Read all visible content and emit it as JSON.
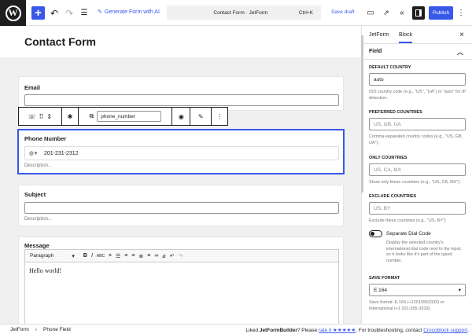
{
  "topbar": {
    "wp_logo": "W",
    "generate_label": "Generate Form with AI",
    "command_title": "Contact Form · JetForm",
    "command_shortcut": "Ctrl+K",
    "save_draft": "Save draft",
    "publish": "Publish"
  },
  "editor": {
    "title": "Contact Form",
    "email_label": "Email",
    "phone_label": "Phone Number",
    "phone_value": "201-231-2312",
    "phone_description": "Description...",
    "subject_label": "Subject",
    "subject_description": "Description...",
    "message_label": "Message",
    "message_format": "Paragraph",
    "message_text": "Hello world!"
  },
  "block_toolbar": {
    "field_name": "phone_number"
  },
  "statusbar": {
    "crumb_root": "JetForm",
    "crumb_separator": "›",
    "crumb_current": "Phone Field",
    "liked_prefix": "Liked",
    "brand": "JetFormBuilder",
    "please": "? Please",
    "rate_link": "rate it ★★★★★",
    "troubleshoot": ". For troubleshooting, contact",
    "support_link": "Crocoblock support",
    "end": "."
  },
  "sidebar": {
    "tab_form": "JetForm",
    "tab_block": "Block",
    "panel_title": "Field",
    "default_country_label": "DEFAULT COUNTRY",
    "default_country_value": "auto",
    "default_country_help": "ISO country code (e.g., \"US\", \"UA\") or \"auto\" for IP detection.",
    "preferred_label": "PREFERRED COUNTRIES",
    "preferred_placeholder": "US, GB, UA",
    "preferred_help": "Comma-separated country codes (e.g., \"US, GB, UA\").",
    "only_label": "ONLY COUNTRIES",
    "only_placeholder": "US, CA, MX",
    "only_help": "Show only these countries (e.g., \"US, CA, MX\").",
    "exclude_label": "EXCLUDE COUNTRIES",
    "exclude_placeholder": "US, BY",
    "exclude_help": "Exclude these countries (e.g., \"US, BY\")",
    "separate_label": "Separate Dial Code",
    "separate_help": "Display the selected country's international dial code next to the input, so it looks like it's part of the typed number.",
    "save_format_label": "SAVE FORMAT",
    "save_format_value": "E.164",
    "save_format_help": "Save format: E.164 (+12015553333) or International (+1 201-555-3333)."
  },
  "colors": {
    "accent": "#3858e9",
    "dark": "#1e1e1e",
    "canvas": "#f0f0f0"
  }
}
